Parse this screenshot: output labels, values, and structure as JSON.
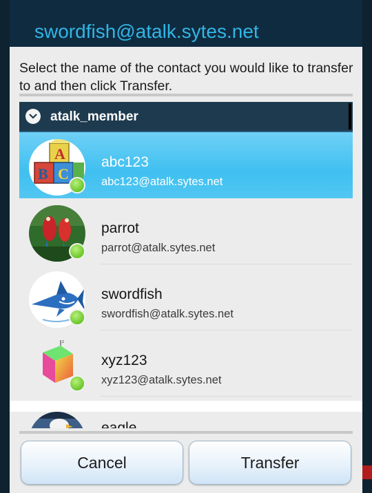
{
  "dialog": {
    "title": "swordfish@atalk.sytes.net",
    "instructions": "Select the name of the contact you would like to transfer to and then click Transfer."
  },
  "group": {
    "name": "atalk_member",
    "icon": "chevron-down-icon"
  },
  "contacts": [
    {
      "name": "abc123",
      "jid": "abc123@atalk.sytes.net",
      "status": "online",
      "selected": true,
      "avatar": "alphabet-blocks"
    },
    {
      "name": "parrot",
      "jid": "parrot@atalk.sytes.net",
      "status": "online",
      "selected": false,
      "avatar": "parrots"
    },
    {
      "name": "swordfish",
      "jid": "swordfish@atalk.sytes.net",
      "status": "online",
      "selected": false,
      "avatar": "swordfish"
    },
    {
      "name": "xyz123",
      "jid": "xyz123@atalk.sytes.net",
      "status": "online",
      "selected": false,
      "avatar": "color-cube"
    }
  ],
  "partial_contact": {
    "name": "eagle",
    "avatar": "eagle"
  },
  "buttons": {
    "cancel": "Cancel",
    "transfer": "Transfer"
  },
  "colors": {
    "title_text": "#33b5e5",
    "title_bar": "#0f2b40",
    "selected_row": "#3fc0f0",
    "group_header": "#1e3a4e",
    "status_online": "#6ac72a"
  }
}
